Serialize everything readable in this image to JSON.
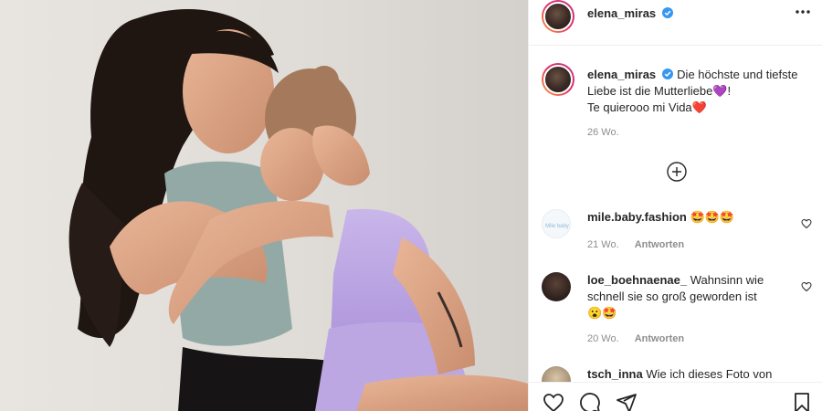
{
  "header": {
    "username": "elena_miras",
    "more_icon": "more-horizontal-icon"
  },
  "caption": {
    "username": "elena_miras",
    "text_line1": "Die höchste und tiefste Liebe ist die Mutterliebe",
    "text_line1_end": "!",
    "text_line2": "Te quierooo mi Vida",
    "purple_heart": "💜",
    "red_heart": "❤️",
    "time": "26 Wo."
  },
  "load_more_icon": "plus-circle-icon",
  "comments": [
    {
      "username": "mile.baby.fashion",
      "text": "",
      "emojis": [
        "🤩",
        "🤩",
        "🤩"
      ],
      "time": "21 Wo.",
      "reply": "Antworten"
    },
    {
      "username": "loe_boehnaenae_",
      "text": "Wahnsinn wie schnell sie so groß geworden ist",
      "emojis": [
        "😮",
        "🤩"
      ],
      "time": "20 Wo.",
      "reply": "Antworten"
    },
    {
      "username": "tsch_inna",
      "text": "Wie ich dieses Foto von",
      "emojis": [],
      "time": "",
      "reply": ""
    }
  ],
  "actions": [
    "heart-icon",
    "comment-icon",
    "share-icon",
    "bookmark-icon"
  ],
  "colors": {
    "verified": "#3897f0",
    "muted": "#8e8e8e",
    "text": "#262626"
  }
}
